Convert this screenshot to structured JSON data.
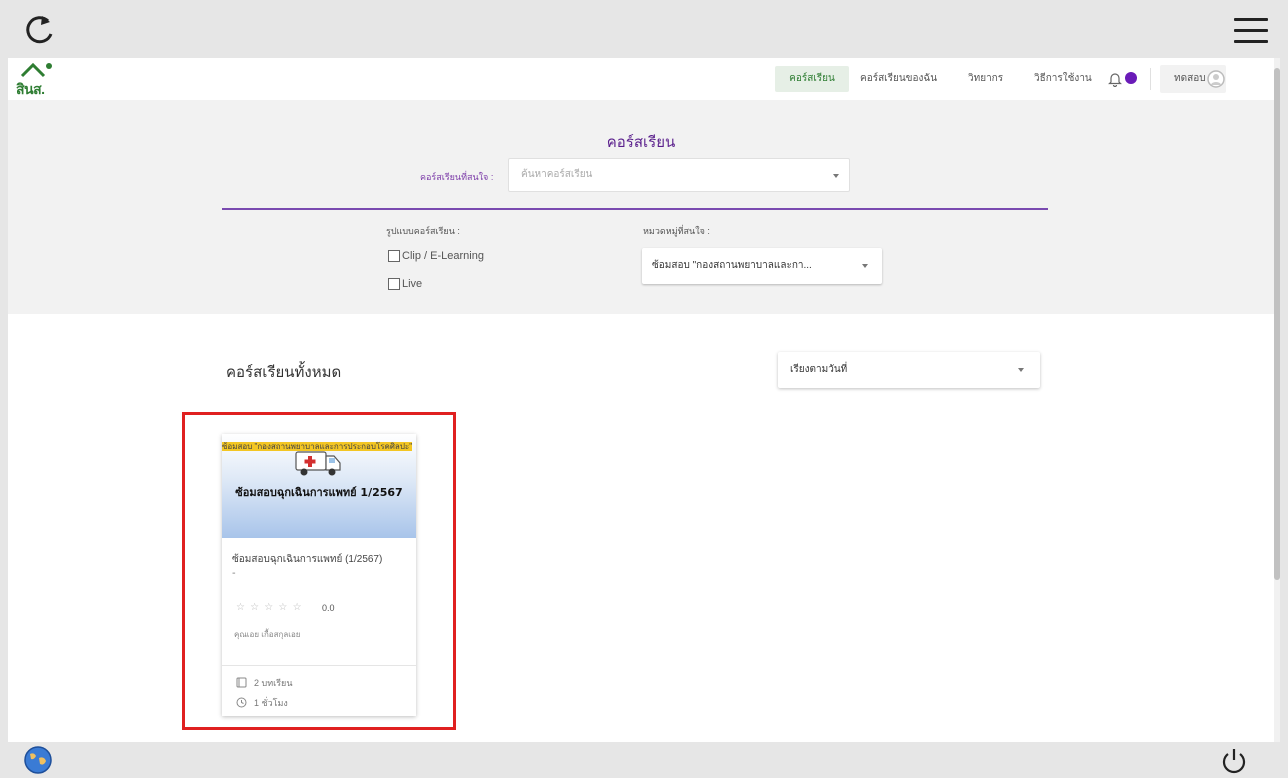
{
  "kiosk": {
    "top_icons": [
      "reload-icon",
      "hamburger-menu-icon"
    ],
    "bottom_icons": [
      "globe-icon",
      "power-icon"
    ]
  },
  "header": {
    "logo_text": "สินส.",
    "nav": {
      "courses": "คอร์สเรียน",
      "my_courses": "คอร์สเรียนของฉัน",
      "speakers": "วิทยากร",
      "how_to": "วิธีการใช้งาน"
    },
    "user_name": "ทดสอบ",
    "accent_color": "#6a1bb8"
  },
  "filter": {
    "title": "คอร์สเรียน",
    "search_label": "คอร์สเรียนที่สนใจ :",
    "search_placeholder": "ค้นหาคอร์สเรียน",
    "type_label": "รูปแบบคอร์สเรียน :",
    "type_options": [
      "Clip / E-Learning",
      "Live"
    ],
    "category_label": "หมวดหมู่ที่สนใจ :",
    "category_value": "ซ้อมสอบ \"กองสถานพยาบาลและกา..."
  },
  "content": {
    "title": "คอร์สเรียนทั้งหมด",
    "sort_value": "เรียงตามวันที่"
  },
  "course_card": {
    "tag": "ซ้อมสอบ \"กองสถานพยาบาลและการประกอบโรคศิลปะ\"",
    "image_title": "ซ้อมสอบฉุกเฉินการแพทย์ 1/2567",
    "name": "ซ้อมสอบฉุกเฉินการแพทย์ (1/2567)",
    "dash": "-",
    "stars": "☆ ☆ ☆ ☆ ☆",
    "rating": "0.0",
    "instructor": "คุณเอย เกื้อสกุลเอย",
    "lessons": "2 บทเรียน",
    "hours": "1 ชั่วโมง"
  }
}
